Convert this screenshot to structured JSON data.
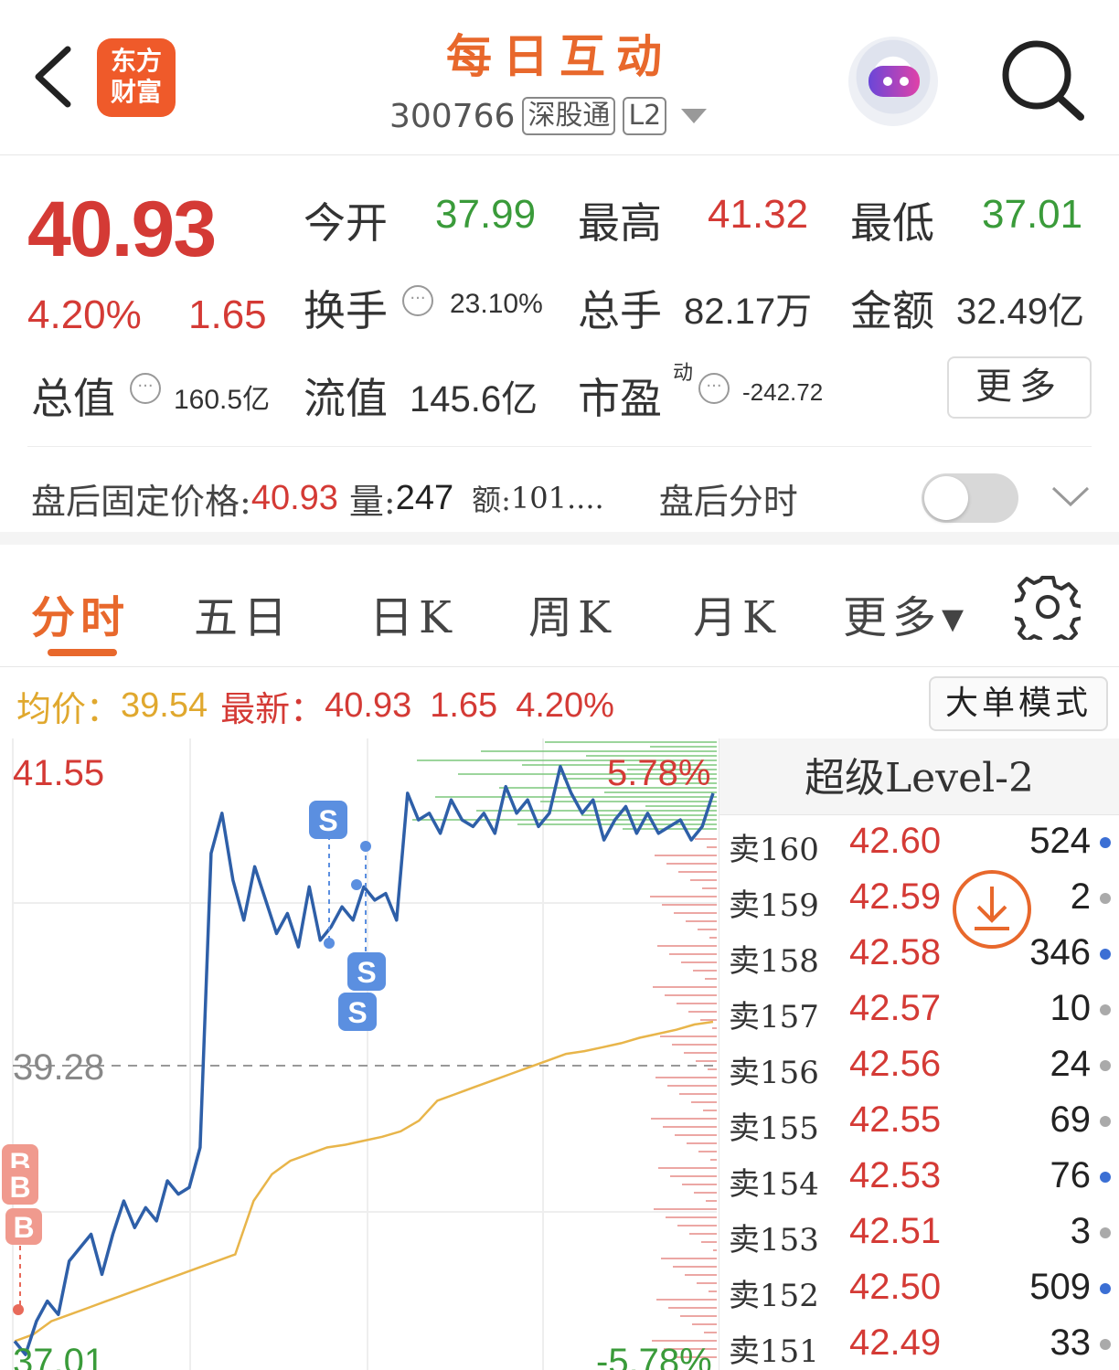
{
  "header": {
    "app_title": "每日互动",
    "logo_text_line1": "东方",
    "logo_text_line2": "财富",
    "stock_code": "300766",
    "tag_connect": "深股通",
    "tag_level": "L2"
  },
  "quote": {
    "price": "40.93",
    "change_pct": "4.20%",
    "change_abs": "1.65",
    "open_label": "今开",
    "open_value": "37.99",
    "high_label": "最高",
    "high_value": "41.32",
    "low_label": "最低",
    "low_value": "37.01",
    "turnover_label": "换手",
    "turnover_value": "23.10%",
    "volume_label": "总手",
    "volume_value": "82.17万",
    "amount_label": "金额",
    "amount_value": "32.49亿",
    "mktcap_label": "总值",
    "mktcap_value": "160.5亿",
    "float_label": "流值",
    "float_value": "145.6亿",
    "pe_label": "市盈",
    "pe_sup": "动",
    "pe_value": "-242.72",
    "more_label": "更多"
  },
  "after_hours": {
    "price_label": "盘后固定价格:",
    "price_value": "40.93",
    "vol_label": "量:",
    "vol_value": "247",
    "amt_label": "额:",
    "amt_value": "101....",
    "intraday_label": "盘后分时"
  },
  "tabs": [
    {
      "label": "分时",
      "active": true
    },
    {
      "label": "五日"
    },
    {
      "label": "日K"
    },
    {
      "label": "周K"
    },
    {
      "label": "月K"
    },
    {
      "label": "更多▾"
    }
  ],
  "info": {
    "avg_label": "均价：",
    "avg_value": "39.54",
    "latest_label": "最新：",
    "latest_value": "40.93",
    "latest_change": "1.65",
    "latest_pct": "4.20%",
    "bigorder_label": "大单模式"
  },
  "chart_labels": {
    "top_price": "41.55",
    "top_pct": "5.78%",
    "mid_price": "39.28",
    "bottom_price": "37.01",
    "bottom_pct": "-5.78%"
  },
  "chart_data": {
    "type": "line",
    "ylim": [
      37.01,
      41.55
    ],
    "reference": 39.28,
    "series": [
      {
        "values": [
          37.15,
          37.05,
          37.3,
          37.45,
          37.35,
          37.75,
          37.85,
          37.95,
          37.65,
          37.95,
          38.2,
          38.0,
          38.15,
          38.05,
          38.35,
          38.25,
          38.3,
          38.6,
          40.8,
          41.1,
          40.6,
          40.3,
          40.7,
          40.45,
          40.2,
          40.35,
          40.1,
          40.55,
          40.15,
          40.25,
          40.4,
          40.3,
          40.55,
          40.45,
          40.5,
          40.3,
          41.25,
          41.05,
          41.1,
          40.95,
          41.2,
          41.05,
          41.0,
          41.1,
          40.95,
          41.3,
          41.1,
          41.2,
          41.0,
          41.1,
          41.45,
          41.25,
          41.1,
          41.2,
          40.9,
          41.05,
          41.15,
          40.95,
          41.1,
          40.95,
          41.0,
          41.05,
          40.9,
          41.0,
          41.25
        ]
      },
      {
        "values": [
          37.15,
          37.2,
          37.3,
          37.35,
          37.4,
          37.45,
          37.5,
          37.55,
          37.6,
          37.65,
          37.7,
          37.75,
          37.8,
          38.2,
          38.4,
          38.5,
          38.55,
          38.6,
          38.62,
          38.65,
          38.68,
          38.72,
          38.8,
          38.95,
          39.0,
          39.05,
          39.1,
          39.15,
          39.2,
          39.25,
          39.3,
          39.32,
          39.35,
          39.38,
          39.42,
          39.45,
          39.48,
          39.52,
          39.54
        ]
      }
    ]
  },
  "level2": {
    "title": "超级Level-2",
    "rows": [
      {
        "label": "卖160",
        "price": "42.60",
        "vol": "524",
        "dot": "#3b6fd4"
      },
      {
        "label": "卖159",
        "price": "42.59",
        "vol": "2",
        "dot": "#aaaaaa"
      },
      {
        "label": "卖158",
        "price": "42.58",
        "vol": "346",
        "dot": "#3b6fd4"
      },
      {
        "label": "卖157",
        "price": "42.57",
        "vol": "10",
        "dot": "#aaaaaa"
      },
      {
        "label": "卖156",
        "price": "42.56",
        "vol": "24",
        "dot": "#aaaaaa"
      },
      {
        "label": "卖155",
        "price": "42.55",
        "vol": "69",
        "dot": "#aaaaaa"
      },
      {
        "label": "卖154",
        "price": "42.53",
        "vol": "76",
        "dot": "#3b6fd4"
      },
      {
        "label": "卖153",
        "price": "42.51",
        "vol": "3",
        "dot": "#aaaaaa"
      },
      {
        "label": "卖152",
        "price": "42.50",
        "vol": "509",
        "dot": "#3b6fd4"
      },
      {
        "label": "卖151",
        "price": "42.49",
        "vol": "33",
        "dot": "#aaaaaa"
      }
    ]
  },
  "colors": {
    "up": "#d43a35",
    "down": "#3a9b3a",
    "accent": "#e8682c",
    "price_line": "#2e5fa8",
    "avg_line": "#e8b54a"
  }
}
